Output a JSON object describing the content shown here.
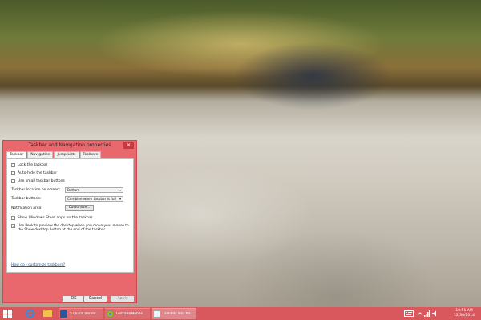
{
  "dialog": {
    "title": "Taskbar and Navigation properties",
    "close_glyph": "✕",
    "tabs": [
      "Taskbar",
      "Navigation",
      "Jump Lists",
      "Toolbars"
    ],
    "options": [
      {
        "label": "Lock the taskbar",
        "checked": false
      },
      {
        "label": "Auto-hide the taskbar",
        "checked": false
      },
      {
        "label": "Use small taskbar buttons",
        "checked": false
      }
    ],
    "location_label": "Taskbar location on screen:",
    "location_value": "Bottom",
    "buttons_label": "Taskbar buttons:",
    "buttons_value": "Combine when taskbar is full",
    "notification_label": "Notification area:",
    "customize_label": "Customize...",
    "show_apps_label": "Show Windows Store apps on the taskbar",
    "peek_label": "Use Peek to preview the desktop when you move your mouse to the Show desktop button at the end of the taskbar",
    "help_link": "How do I customize taskbars?",
    "ok_label": "OK",
    "cancel_label": "Cancel",
    "apply_label": "Apply",
    "check_glyph": "✓",
    "chevron": "▾"
  },
  "taskbar": {
    "items": [
      {
        "label": "5 Quick Windo...",
        "icon": "word-icon"
      },
      {
        "label": "GottaBeMobile...",
        "icon": "chrome-icon"
      },
      {
        "label": "Taskbar and Na...",
        "icon": "taskbar-properties-icon"
      }
    ],
    "time": "10:51 AM",
    "date": "12/30/2014"
  },
  "colors": {
    "accent": "#e9686e",
    "taskbar": "#d9585e"
  }
}
